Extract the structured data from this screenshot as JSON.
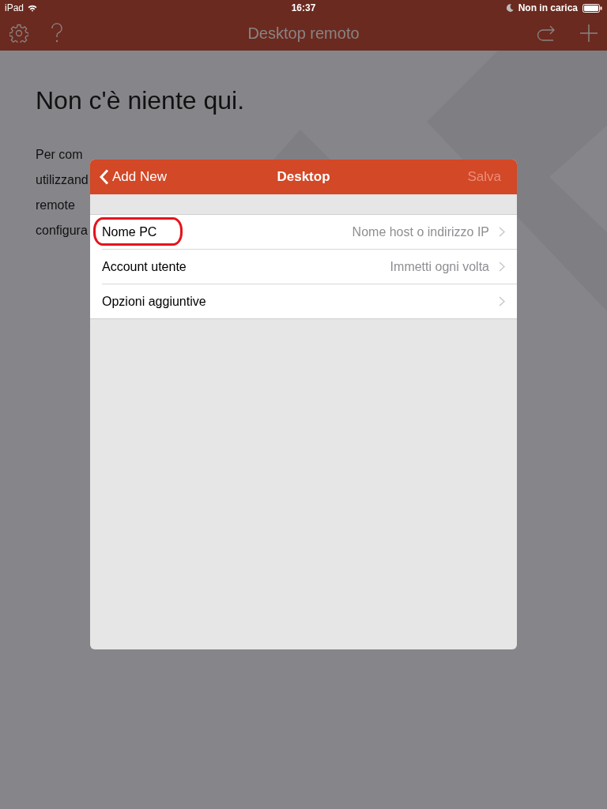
{
  "status_bar": {
    "carrier": "iPad",
    "time": "16:37",
    "battery_status": "Non in carica"
  },
  "nav_bar": {
    "title": "Desktop remoto"
  },
  "empty_state": {
    "heading": "Non c'è niente qui.",
    "paragraph_lines": [
      "Per  com",
      "utilizzand",
      "remote",
      "configura"
    ]
  },
  "dialog": {
    "back_label": "Add New",
    "title": "Desktop",
    "save_label": "Salva",
    "save_disabled": true,
    "rows": [
      {
        "label": "Nome PC",
        "value": "Nome host o indirizzo IP",
        "highlighted": true
      },
      {
        "label": "Account utente",
        "value": "Immetti ogni volta",
        "highlighted": false
      },
      {
        "label": "Opzioni aggiuntive",
        "highlighted": false
      }
    ]
  }
}
